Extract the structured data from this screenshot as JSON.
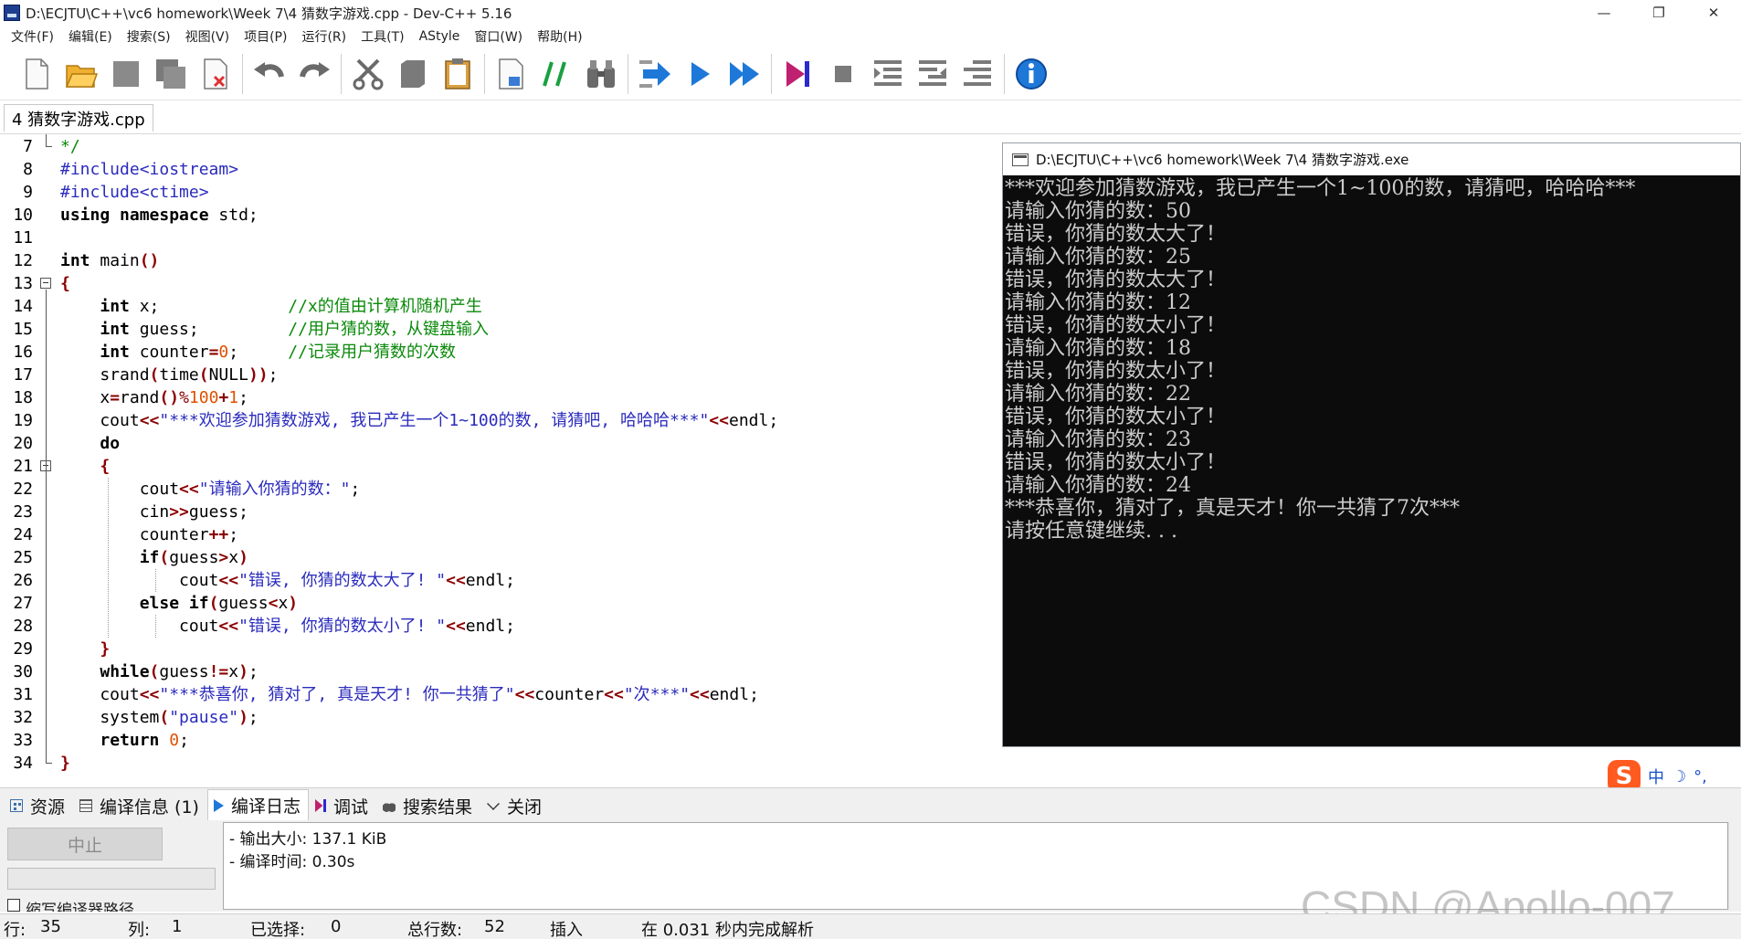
{
  "window": {
    "title": "D:\\ECJTU\\C++\\vc6 homework\\Week 7\\4 猜数字游戏.cpp - Dev-C++ 5.16",
    "minimize": "—",
    "restore": "❐",
    "close": "✕"
  },
  "menu": [
    "文件(F)",
    "编辑(E)",
    "搜索(S)",
    "视图(V)",
    "项目(P)",
    "运行(R)",
    "工具(T)",
    "AStyle",
    "窗口(W)",
    "帮助(H)"
  ],
  "editor": {
    "tab_label": "4 猜数字游戏.cpp",
    "first_line_number": 7,
    "lines": [
      [
        [
          "*/",
          "#0a8a0a",
          "normal"
        ]
      ],
      [
        [
          "#include<iostream>",
          "#2b2bbd",
          "normal"
        ]
      ],
      [
        [
          "#include<ctime>",
          "#2b2bbd",
          "normal"
        ]
      ],
      [
        [
          "using namespace",
          "#000000",
          "bold"
        ],
        [
          " std;",
          "#000000",
          "normal"
        ]
      ],
      [],
      [
        [
          "int",
          "#000000",
          "bold"
        ],
        [
          " main",
          "#000000",
          "normal"
        ],
        [
          "()",
          "#8b0000",
          "bold"
        ]
      ],
      [
        [
          "{",
          "#8b0000",
          "bold"
        ]
      ],
      [
        [
          "    ",
          "#000000",
          "normal"
        ],
        [
          "int",
          "#000000",
          "bold"
        ],
        [
          " x;             ",
          "#000000",
          "normal"
        ],
        [
          "//x的值由计算机随机产生",
          "#0a8a0a",
          "normal"
        ]
      ],
      [
        [
          "    ",
          "#000000",
          "normal"
        ],
        [
          "int",
          "#000000",
          "bold"
        ],
        [
          " guess;         ",
          "#000000",
          "normal"
        ],
        [
          "//用户猜的数，从键盘输入",
          "#0a8a0a",
          "normal"
        ]
      ],
      [
        [
          "    ",
          "#000000",
          "normal"
        ],
        [
          "int",
          "#000000",
          "bold"
        ],
        [
          " counter",
          "#000000",
          "normal"
        ],
        [
          "=",
          "#8b0000",
          "bold"
        ],
        [
          "0",
          "#e05000",
          "normal"
        ],
        [
          ";     ",
          "#000000",
          "normal"
        ],
        [
          "//记录用户猜数的次数",
          "#0a8a0a",
          "normal"
        ]
      ],
      [
        [
          "    srand",
          "#000000",
          "normal"
        ],
        [
          "(",
          "#8b0000",
          "bold"
        ],
        [
          "time",
          "#000000",
          "normal"
        ],
        [
          "(",
          "#8b0000",
          "bold"
        ],
        [
          "NULL",
          "#000000",
          "normal"
        ],
        [
          "))",
          "#8b0000",
          "bold"
        ],
        [
          ";",
          "#000000",
          "normal"
        ]
      ],
      [
        [
          "    x",
          "#000000",
          "normal"
        ],
        [
          "=",
          "#8b0000",
          "bold"
        ],
        [
          "rand",
          "#000000",
          "normal"
        ],
        [
          "()",
          "#8b0000",
          "bold"
        ],
        [
          "%",
          "#8b0000",
          "normal"
        ],
        [
          "100",
          "#e05000",
          "normal"
        ],
        [
          "+",
          "#8b0000",
          "bold"
        ],
        [
          "1",
          "#e05000",
          "normal"
        ],
        [
          ";",
          "#000000",
          "normal"
        ]
      ],
      [
        [
          "    cout",
          "#000000",
          "normal"
        ],
        [
          "<<",
          "#8b0000",
          "bold"
        ],
        [
          "\"***欢迎参加猜数游戏, 我已产生一个1~100的数, 请猜吧, 哈哈哈***\"",
          "#2b2bbd",
          "normal"
        ],
        [
          "<<",
          "#8b0000",
          "bold"
        ],
        [
          "endl;",
          "#000000",
          "normal"
        ]
      ],
      [
        [
          "    ",
          "#000000",
          "normal"
        ],
        [
          "do",
          "#000000",
          "bold"
        ]
      ],
      [
        [
          "    ",
          "#000000",
          "normal"
        ],
        [
          "{",
          "#8b0000",
          "bold"
        ]
      ],
      [
        [
          "        cout",
          "#000000",
          "normal"
        ],
        [
          "<<",
          "#8b0000",
          "bold"
        ],
        [
          "\"请输入你猜的数：\"",
          "#2b2bbd",
          "normal"
        ],
        [
          ";",
          "#000000",
          "normal"
        ]
      ],
      [
        [
          "        cin",
          "#000000",
          "normal"
        ],
        [
          ">>",
          "#8b0000",
          "bold"
        ],
        [
          "guess;",
          "#000000",
          "normal"
        ]
      ],
      [
        [
          "        counter",
          "#000000",
          "normal"
        ],
        [
          "++",
          "#8b0000",
          "bold"
        ],
        [
          ";",
          "#000000",
          "normal"
        ]
      ],
      [
        [
          "        ",
          "#000000",
          "normal"
        ],
        [
          "if",
          "#000000",
          "bold"
        ],
        [
          "(",
          "#8b0000",
          "bold"
        ],
        [
          "guess",
          "#000000",
          "normal"
        ],
        [
          ">",
          "#8b0000",
          "bold"
        ],
        [
          "x",
          "#000000",
          "normal"
        ],
        [
          ")",
          "#8b0000",
          "bold"
        ]
      ],
      [
        [
          "            cout",
          "#000000",
          "normal"
        ],
        [
          "<<",
          "#8b0000",
          "bold"
        ],
        [
          "\"错误, 你猜的数太大了! \"",
          "#2b2bbd",
          "normal"
        ],
        [
          "<<",
          "#8b0000",
          "bold"
        ],
        [
          "endl;",
          "#000000",
          "normal"
        ]
      ],
      [
        [
          "        ",
          "#000000",
          "normal"
        ],
        [
          "else if",
          "#000000",
          "bold"
        ],
        [
          "(",
          "#8b0000",
          "bold"
        ],
        [
          "guess",
          "#000000",
          "normal"
        ],
        [
          "<",
          "#8b0000",
          "bold"
        ],
        [
          "x",
          "#000000",
          "normal"
        ],
        [
          ")",
          "#8b0000",
          "bold"
        ]
      ],
      [
        [
          "            cout",
          "#000000",
          "normal"
        ],
        [
          "<<",
          "#8b0000",
          "bold"
        ],
        [
          "\"错误, 你猜的数太小了! \"",
          "#2b2bbd",
          "normal"
        ],
        [
          "<<",
          "#8b0000",
          "bold"
        ],
        [
          "endl;",
          "#000000",
          "normal"
        ]
      ],
      [
        [
          "    ",
          "#000000",
          "normal"
        ],
        [
          "}",
          "#8b0000",
          "bold"
        ]
      ],
      [
        [
          "    ",
          "#000000",
          "normal"
        ],
        [
          "while",
          "#000000",
          "bold"
        ],
        [
          "(",
          "#8b0000",
          "bold"
        ],
        [
          "guess",
          "#000000",
          "normal"
        ],
        [
          "!=",
          "#8b0000",
          "bold"
        ],
        [
          "x",
          "#000000",
          "normal"
        ],
        [
          ")",
          "#8b0000",
          "bold"
        ],
        [
          ";",
          "#000000",
          "normal"
        ]
      ],
      [
        [
          "    cout",
          "#000000",
          "normal"
        ],
        [
          "<<",
          "#8b0000",
          "bold"
        ],
        [
          "\"***恭喜你, 猜对了, 真是天才! 你一共猜了\"",
          "#2b2bbd",
          "normal"
        ],
        [
          "<<",
          "#8b0000",
          "bold"
        ],
        [
          "counter",
          "#000000",
          "normal"
        ],
        [
          "<<",
          "#8b0000",
          "bold"
        ],
        [
          "\"次***\"",
          "#2b2bbd",
          "normal"
        ],
        [
          "<<",
          "#8b0000",
          "bold"
        ],
        [
          "endl;",
          "#000000",
          "normal"
        ]
      ],
      [
        [
          "    system",
          "#000000",
          "normal"
        ],
        [
          "(",
          "#8b0000",
          "bold"
        ],
        [
          "\"pause\"",
          "#2b2bbd",
          "normal"
        ],
        [
          ")",
          "#8b0000",
          "bold"
        ],
        [
          ";",
          "#000000",
          "normal"
        ]
      ],
      [
        [
          "    ",
          "#000000",
          "normal"
        ],
        [
          "return",
          "#000000",
          "bold"
        ],
        [
          " ",
          "#000000",
          "normal"
        ],
        [
          "0",
          "#e05000",
          "normal"
        ],
        [
          ";",
          "#000000",
          "normal"
        ]
      ],
      [
        [
          "}",
          "#8b0000",
          "bold"
        ]
      ]
    ]
  },
  "console": {
    "title": "D:\\ECJTU\\C++\\vc6 homework\\Week 7\\4 猜数字游戏.exe",
    "lines": [
      "***欢迎参加猜数游戏，我已产生一个1~100的数，请猜吧，哈哈哈***",
      "请输入你猜的数：50",
      "错误，你猜的数太大了！",
      "请输入你猜的数：25",
      "错误，你猜的数太大了！",
      "请输入你猜的数：12",
      "错误，你猜的数太小了！",
      "请输入你猜的数：18",
      "错误，你猜的数太小了！",
      "请输入你猜的数：22",
      "错误，你猜的数太小了！",
      "请输入你猜的数：23",
      "错误，你猜的数太小了！",
      "请输入你猜的数：24",
      "***恭喜你，猜对了，真是天才！你一共猜了7次***",
      "请按任意键继续. . ."
    ]
  },
  "ime": {
    "logo": "S",
    "mode": "中",
    "moon": "☽",
    "punct": "°,"
  },
  "bottom": {
    "tabs": [
      "资源",
      "编译信息 (1)",
      "编译日志",
      "调试",
      "搜索结果",
      "关闭"
    ],
    "abort_label": "中止",
    "shorten_label": "缩写编译器路径",
    "log": [
      "- 输出大小: 137.1 KiB",
      "- 编译时间: 0.30s"
    ]
  },
  "watermark": "CSDN @Apollo-007",
  "status": {
    "row_label": "行:",
    "row": "35",
    "col_label": "列:",
    "col": "1",
    "sel_label": "已选择:",
    "sel": "0",
    "total_label": "总行数:",
    "total": "52",
    "mode": "插入",
    "parse": "在 0.031 秒内完成解析"
  },
  "colors": {
    "console_bg": "#0c0c0c",
    "console_fg": "#cccccc",
    "keyword": "#000000",
    "string": "#2b2bbd",
    "comment": "#0a8a0a",
    "number": "#e05000",
    "symbol": "#8b0000"
  }
}
